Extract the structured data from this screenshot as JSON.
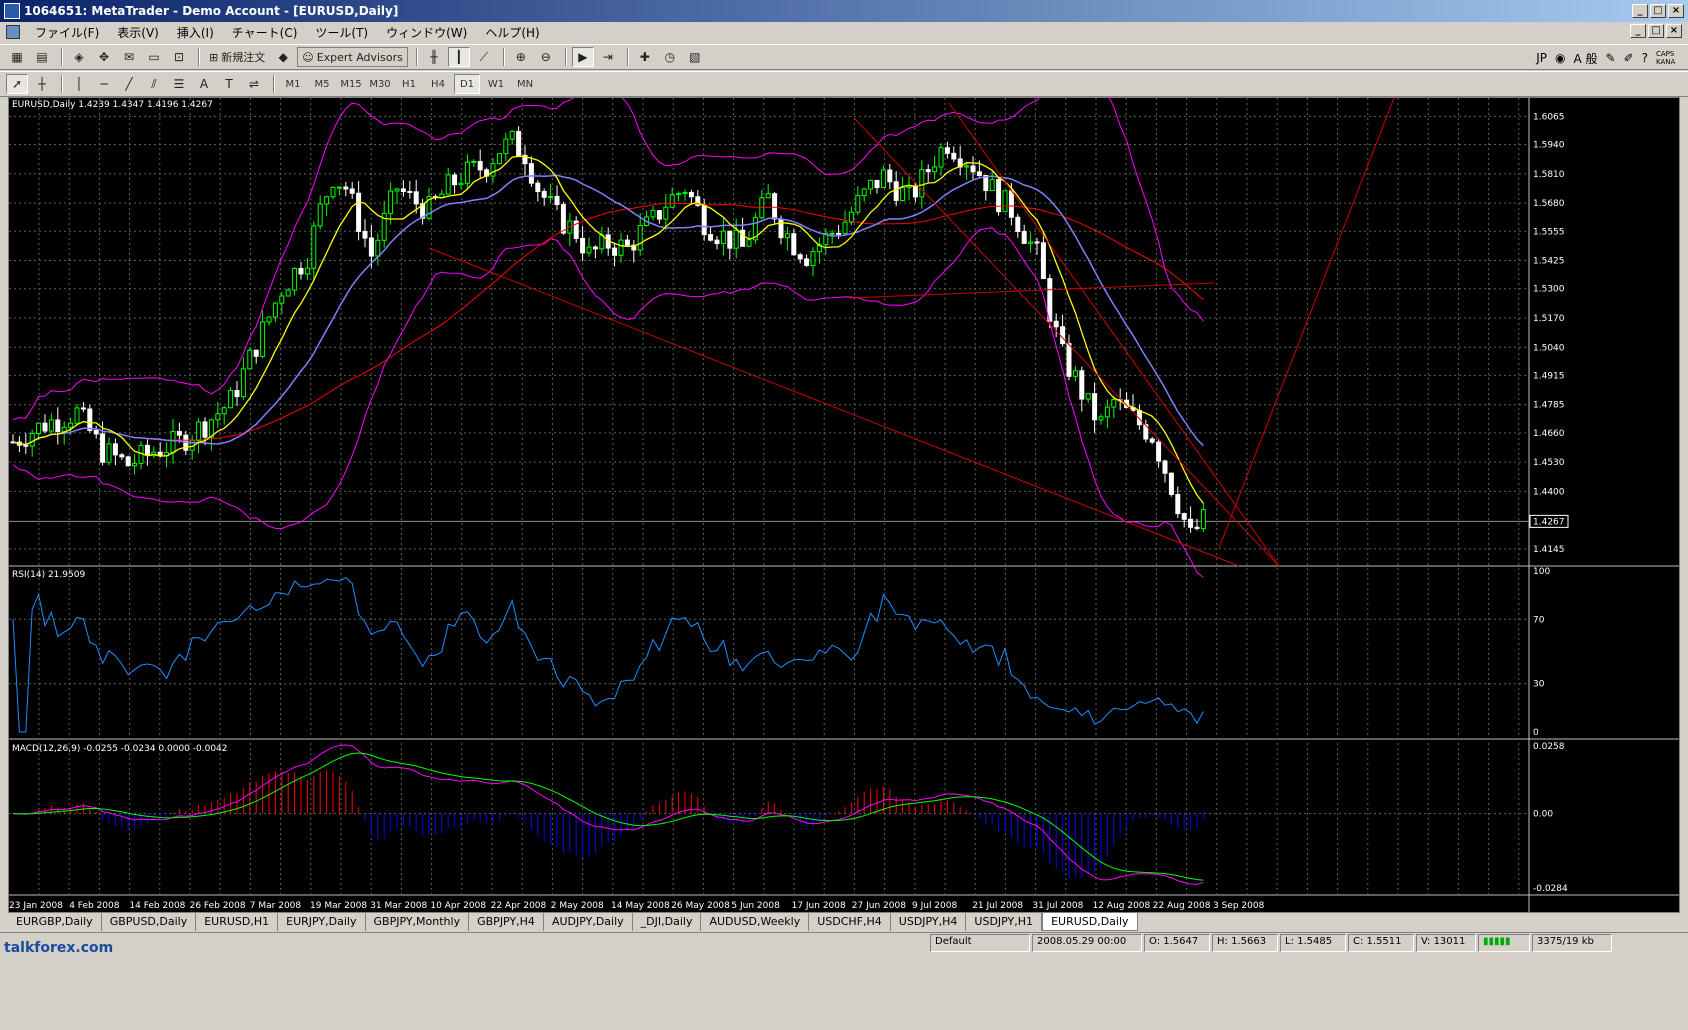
{
  "window": {
    "title": "1064651: MetaTrader - Demo Account - [EURUSD,Daily]",
    "buttons": [
      "_",
      "□",
      "×"
    ]
  },
  "menu": {
    "items": [
      "ファイル(F)",
      "表示(V)",
      "挿入(I)",
      "チャート(C)",
      "ツール(T)",
      "ウィンドウ(W)",
      "ヘルプ(H)"
    ]
  },
  "toolbar": {
    "new_order": "新規注文",
    "expert_advisors": "Expert Advisors",
    "timeframes": [
      "M1",
      "M5",
      "M15",
      "M30",
      "H1",
      "H4",
      "D1",
      "W1",
      "MN"
    ],
    "active_timeframe": "D1",
    "lang": "JP",
    "ime": "A 般",
    "caps_kana": "CAPS KANA"
  },
  "chart": {
    "header": "EURUSD,Daily  1.4239 1.4347 1.4196 1.4267",
    "price_ticks": [
      "1.6065",
      "1.5940",
      "1.5810",
      "1.5680",
      "1.5555",
      "1.5425",
      "1.5300",
      "1.5170",
      "1.5040",
      "1.4915",
      "1.4785",
      "1.4660",
      "1.4530",
      "1.4400",
      "1.4267",
      "1.4145"
    ],
    "current_price": "1.4267",
    "rsi_header": "RSI(14) 21.9509",
    "rsi_ticks": [
      "100",
      "70",
      "30",
      "0"
    ],
    "macd_header": "MACD(12,26,9) -0.0255 -0.0234 0.0000 -0.0042",
    "macd_ticks": [
      "0.0258",
      "0.00",
      "-0.0284"
    ],
    "date_ticks": [
      "23 Jan 2008",
      "4 Feb 2008",
      "14 Feb 2008",
      "26 Feb 2008",
      "7 Mar 2008",
      "19 Mar 2008",
      "31 Mar 2008",
      "10 Apr 2008",
      "22 Apr 2008",
      "2 May 2008",
      "14 May 2008",
      "26 May 2008",
      "5 Jun 2008",
      "17 Jun 2008",
      "27 Jun 2008",
      "9 Jul 2008",
      "21 Jul 2008",
      "31 Jul 2008",
      "12 Aug 2008",
      "22 Aug 2008",
      "3 Sep 2008"
    ],
    "colors": {
      "bull": "#00ff00",
      "bear": "#ffffff",
      "grid": "#606060",
      "boll": "#ff00ff",
      "ma_fast": "#ffff00",
      "ma_mid": "#8080ff",
      "ma_slow": "#ff0000",
      "rsi": "#1e90ff",
      "macd_pos": "#ff0000",
      "macd_neg": "#0000ff",
      "macd_main": "#ff00ff",
      "macd_signal": "#00ff00",
      "trendline": "#cc0000"
    }
  },
  "tabs": [
    "EURGBP,Daily",
    "GBPUSD,Daily",
    "EURUSD,H1",
    "EURJPY,Daily",
    "GBPJPY,Monthly",
    "GBPJPY,H4",
    "AUDJPY,Daily",
    "_DJI,Daily",
    "AUDUSD,Weekly",
    "USDCHF,H4",
    "USDJPY,H4",
    "USDJPY,H1",
    "EURUSD,Daily"
  ],
  "active_tab": "EURUSD,Daily",
  "status": {
    "profile": "Default",
    "datetime": "2008.05.29 00:00",
    "open": "O: 1.5647",
    "high": "H: 1.5663",
    "low": "L: 1.5485",
    "close": "C: 1.5511",
    "volume": "V: 13011",
    "traffic": "3375/19 kb"
  },
  "watermark": "talkforex.com"
}
